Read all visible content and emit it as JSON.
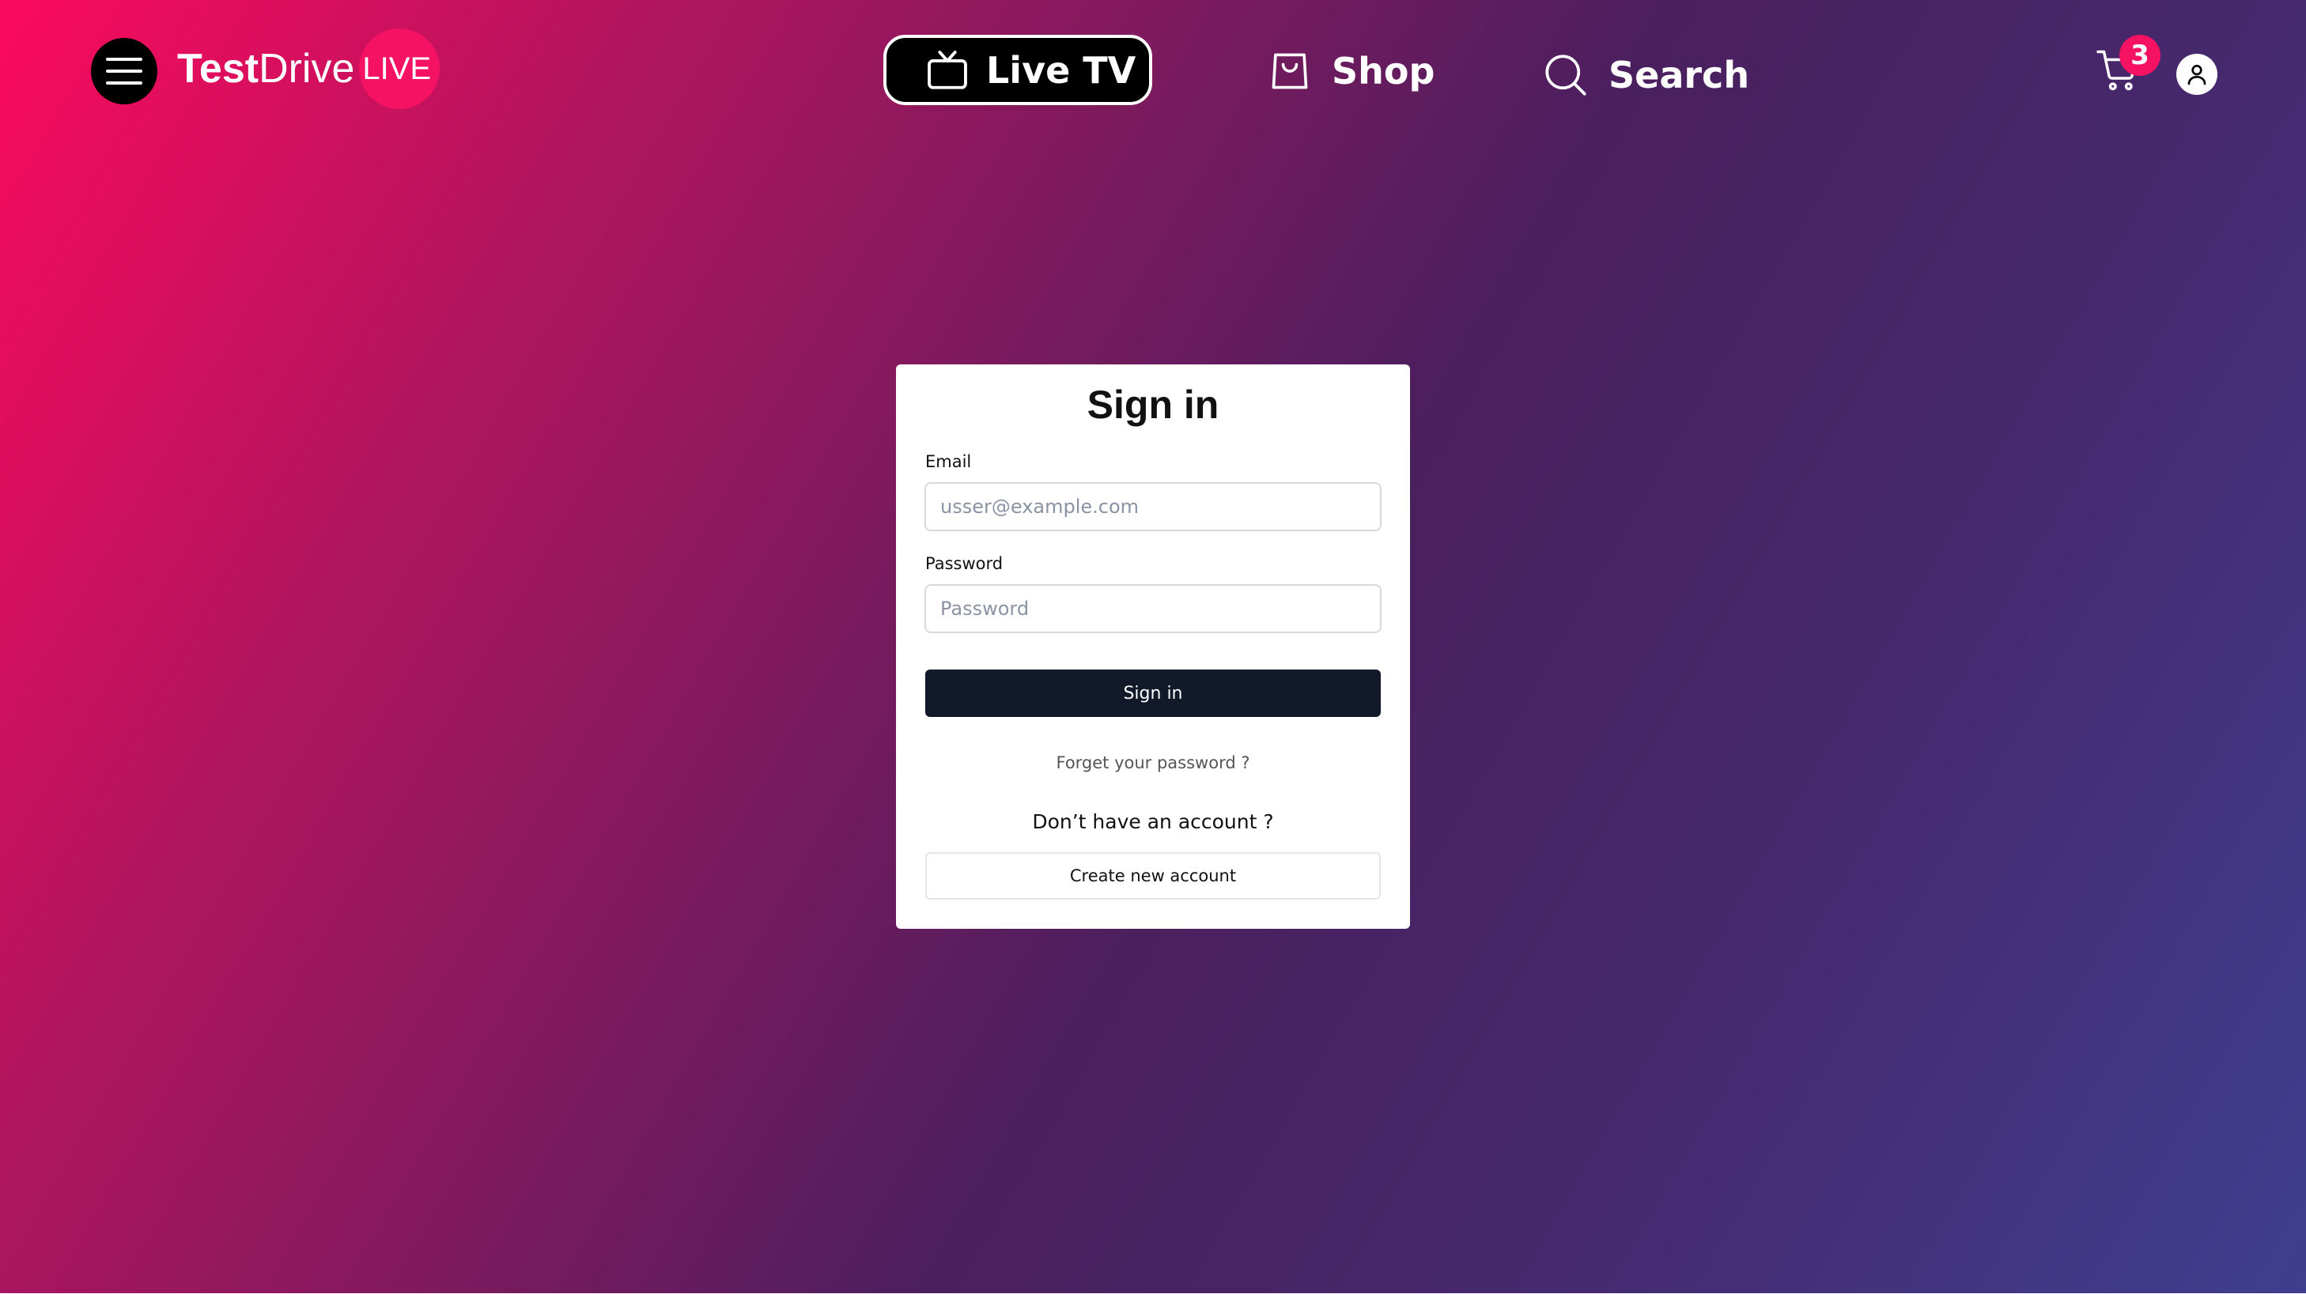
{
  "header": {
    "brand": {
      "part1": "Test",
      "part2": "Drive",
      "live": "LIVE"
    },
    "nav": {
      "live_tv": "Live TV",
      "shop": "Shop",
      "search": "Search"
    },
    "cart_count": "3"
  },
  "signin": {
    "title": "Sign in",
    "email_label": "Email",
    "email_placeholder": "usser@example.com",
    "password_label": "Password",
    "password_placeholder": "Password",
    "submit_label": "Sign in",
    "forgot_label": "Forget your password ?",
    "no_account_text": "Don’t have an account ?",
    "create_account_label": "Create new account"
  },
  "colors": {
    "accent": "#f51263",
    "button_dark": "#121a29"
  },
  "icons": {
    "menu": "hamburger-menu-icon",
    "tv": "tv-icon",
    "shop": "shopping-bag-icon",
    "search": "search-icon",
    "cart": "cart-icon",
    "account": "user-icon"
  }
}
